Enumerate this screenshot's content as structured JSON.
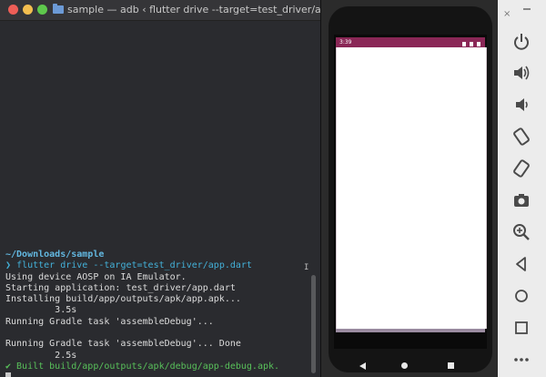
{
  "terminal": {
    "window_title": "sample — adb ‹ flutter drive --target=test_driver/app.da...",
    "cwd": "~/Downloads/sample",
    "prompt_symbol": "❯",
    "command": "flutter drive --target=test_driver/app.dart",
    "lines": [
      "Using device AOSP on IA Emulator.",
      "Starting application: test_driver/app.dart",
      "Installing build/app/outputs/apk/app.apk...",
      "         3.5s",
      "Running Gradle task 'assembleDebug'...",
      "",
      "Running Gradle task 'assembleDebug'... Done",
      "         2.5s"
    ],
    "success_line": "✔ Built build/app/outputs/apk/debug/app-debug.apk."
  },
  "emulator": {
    "status_time": "3:39",
    "status_bar_color": "#8a2756",
    "app_background": "#ffffff",
    "nav": [
      "back-icon",
      "home-icon",
      "recents-icon"
    ]
  },
  "toolbar": {
    "close_label": "×",
    "buttons": [
      "power-icon",
      "volume-up-icon",
      "volume-down-icon",
      "rotate-left-icon",
      "rotate-right-icon",
      "camera-icon",
      "zoom-icon",
      "back-icon",
      "home-icon",
      "overview-icon",
      "more-icon"
    ]
  },
  "colors": {
    "terminal_bg": "#2a2b2f",
    "accent_blue": "#43b0d8",
    "success_green": "#58c05a",
    "toolbar_icon": "#4a4a4a"
  }
}
